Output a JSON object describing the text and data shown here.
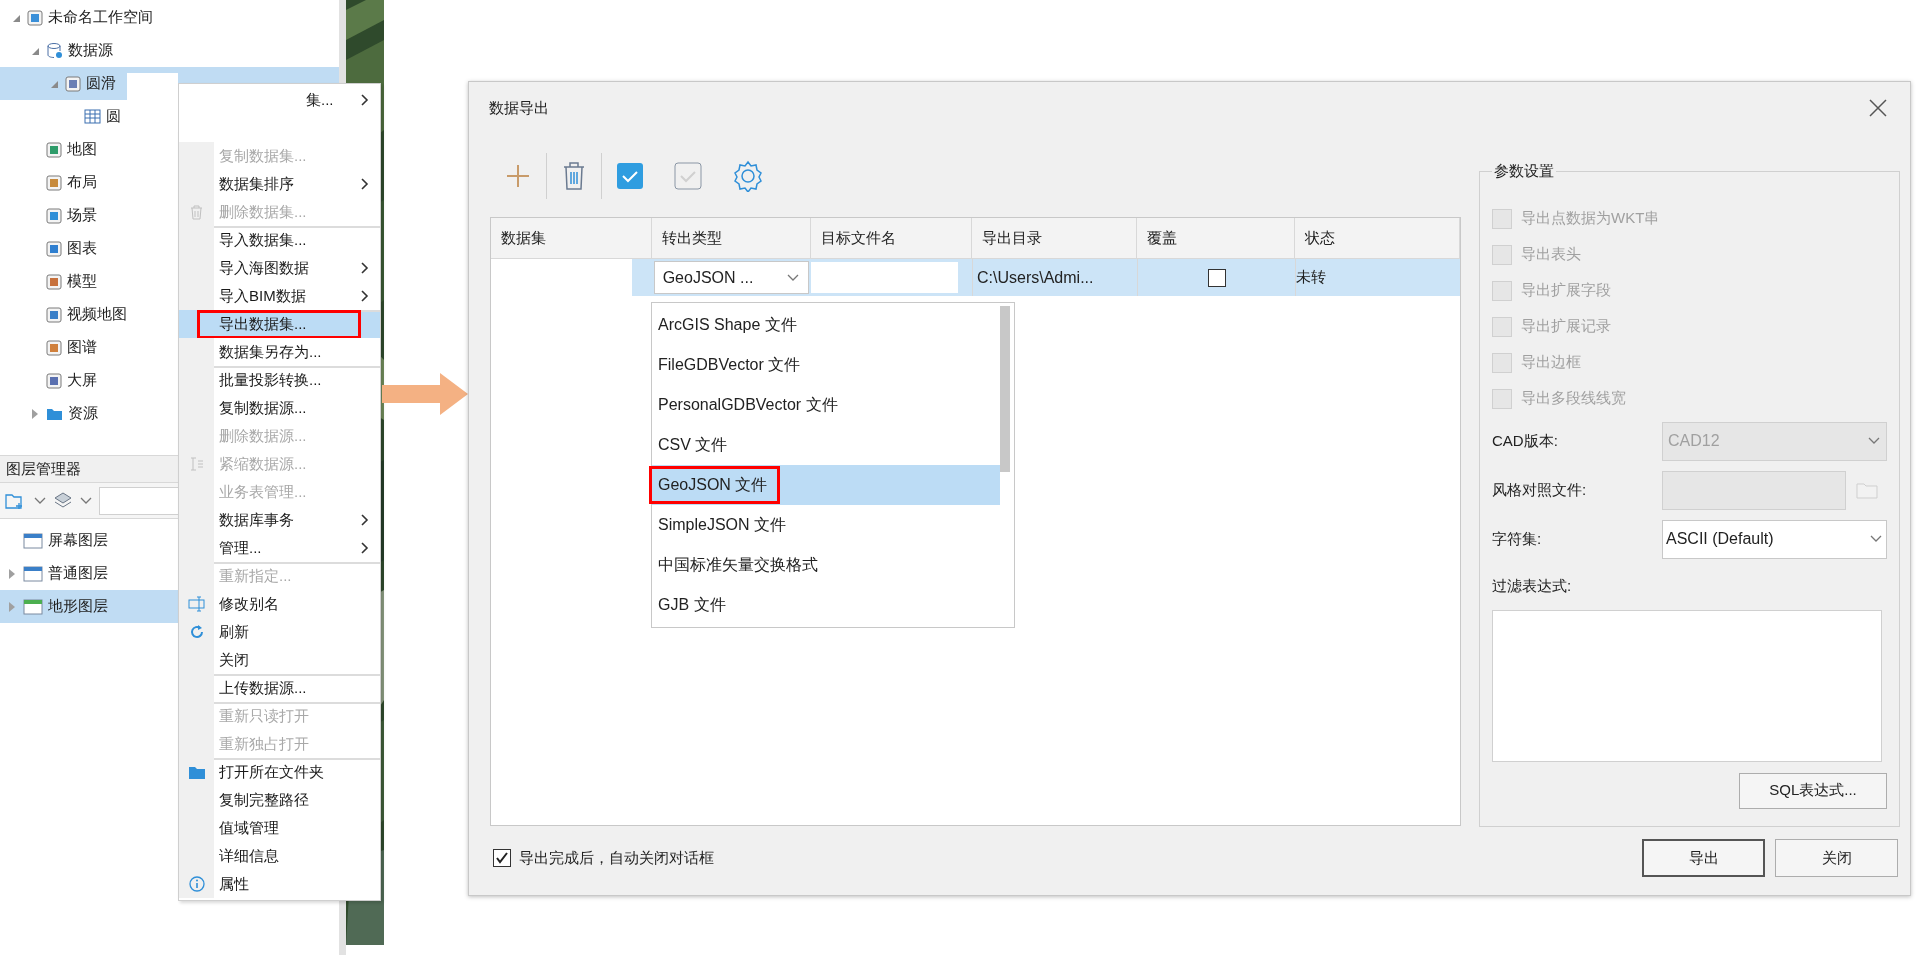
{
  "workspace_tree": {
    "items": [
      {
        "label": "未命名工作空间",
        "kind": "workspace",
        "expanded": true,
        "selected": false,
        "children": [
          {
            "label": "数据源",
            "kind": "datasource",
            "expanded": true,
            "selected": false,
            "children": [
              {
                "label": "圆滑",
                "kind": "vector",
                "expanded": true,
                "selected": true,
                "children": [
                  {
                    "label": "圆",
                    "kind": "table",
                    "selected": false
                  }
                ]
              }
            ]
          },
          {
            "label": "地图",
            "kind": "map",
            "selected": false
          },
          {
            "label": "布局",
            "kind": "layout",
            "selected": false
          },
          {
            "label": "场景",
            "kind": "scene",
            "selected": false
          },
          {
            "label": "图表",
            "kind": "chart",
            "selected": false
          },
          {
            "label": "模型",
            "kind": "model",
            "selected": false
          },
          {
            "label": "视频地图",
            "kind": "video",
            "selected": false
          },
          {
            "label": "图谱",
            "kind": "graph",
            "selected": false
          },
          {
            "label": "大屏",
            "kind": "screen",
            "selected": false
          },
          {
            "label": "资源",
            "kind": "folder",
            "expanded": false,
            "selected": false
          }
        ]
      }
    ]
  },
  "layer_manager": {
    "title": "图层管理器",
    "layers": [
      {
        "label": "屏幕图层",
        "kind": "screen",
        "selected": false
      },
      {
        "label": "普通图层",
        "kind": "normal",
        "expanded": false,
        "selected": false
      },
      {
        "label": "地形图层",
        "kind": "terrain",
        "expanded": false,
        "selected": true
      }
    ]
  },
  "context_menu": {
    "items": [
      {
        "kind": "clipped",
        "label": "集...",
        "submenu": true,
        "disabled": false,
        "selected": false,
        "separator_before": false
      },
      {
        "kind": "hidden"
      },
      {
        "kind": "plain",
        "label": "复制数据集...",
        "submenu": false,
        "disabled": true,
        "selected": false,
        "separator_before": false
      },
      {
        "kind": "plain",
        "label": "数据集排序",
        "submenu": true,
        "disabled": false,
        "selected": false,
        "separator_before": false
      },
      {
        "kind": "trash",
        "label": "删除数据集...",
        "submenu": false,
        "disabled": true,
        "selected": false,
        "separator_before": false
      },
      {
        "kind": "plain",
        "label": "导入数据集...",
        "submenu": false,
        "disabled": false,
        "selected": false,
        "separator_before": true
      },
      {
        "kind": "plain",
        "label": "导入海图数据",
        "submenu": true,
        "disabled": false,
        "selected": false,
        "separator_before": false
      },
      {
        "kind": "plain",
        "label": "导入BIM数据",
        "submenu": true,
        "disabled": false,
        "selected": false,
        "separator_before": false
      },
      {
        "kind": "plain",
        "label": "导出数据集...",
        "submenu": false,
        "disabled": false,
        "selected": true,
        "annotated": true,
        "separator_before": true
      },
      {
        "kind": "plain",
        "label": "数据集另存为...",
        "submenu": false,
        "disabled": false,
        "selected": false,
        "separator_before": false
      },
      {
        "kind": "plain",
        "label": "批量投影转换...",
        "submenu": false,
        "disabled": false,
        "selected": false,
        "separator_before": true
      },
      {
        "kind": "plain",
        "label": "复制数据源...",
        "submenu": false,
        "disabled": false,
        "selected": false,
        "separator_before": false
      },
      {
        "kind": "plain",
        "label": "删除数据源...",
        "submenu": false,
        "disabled": true,
        "selected": false,
        "separator_before": false
      },
      {
        "kind": "compact",
        "label": "紧缩数据源...",
        "submenu": false,
        "disabled": true,
        "selected": false,
        "separator_before": false
      },
      {
        "kind": "plain",
        "label": "业务表管理...",
        "submenu": false,
        "disabled": true,
        "selected": false,
        "separator_before": false
      },
      {
        "kind": "plain",
        "label": "数据库事务",
        "submenu": true,
        "disabled": false,
        "selected": false,
        "separator_before": false
      },
      {
        "kind": "plain",
        "label": "管理...",
        "submenu": true,
        "disabled": false,
        "selected": false,
        "separator_before": false
      },
      {
        "kind": "plain",
        "label": "重新指定...",
        "submenu": false,
        "disabled": true,
        "selected": false,
        "separator_before": true
      },
      {
        "kind": "rename",
        "label": "修改别名",
        "submenu": false,
        "disabled": false,
        "selected": false,
        "separator_before": false
      },
      {
        "kind": "refresh",
        "label": "刷新",
        "submenu": false,
        "disabled": false,
        "selected": false,
        "separator_before": false
      },
      {
        "kind": "plain",
        "label": "关闭",
        "submenu": false,
        "disabled": false,
        "selected": false,
        "separator_before": false
      },
      {
        "kind": "plain",
        "label": "上传数据源...",
        "submenu": false,
        "disabled": false,
        "selected": false,
        "separator_before": true
      },
      {
        "kind": "plain",
        "label": "重新只读打开",
        "submenu": false,
        "disabled": true,
        "selected": false,
        "separator_before": true
      },
      {
        "kind": "plain",
        "label": "重新独占打开",
        "submenu": false,
        "disabled": true,
        "selected": false,
        "separator_before": false
      },
      {
        "kind": "folder",
        "label": "打开所在文件夹",
        "submenu": false,
        "disabled": false,
        "selected": false,
        "separator_before": true
      },
      {
        "kind": "plain",
        "label": "复制完整路径",
        "submenu": false,
        "disabled": false,
        "selected": false,
        "separator_before": false
      },
      {
        "kind": "plain",
        "label": "值域管理",
        "submenu": false,
        "disabled": false,
        "selected": false,
        "separator_before": false
      },
      {
        "kind": "plain",
        "label": "详细信息",
        "submenu": false,
        "disabled": false,
        "selected": false,
        "separator_before": false
      },
      {
        "kind": "info",
        "label": "属性",
        "submenu": false,
        "disabled": false,
        "selected": false,
        "separator_before": false
      }
    ]
  },
  "dialog": {
    "title": "数据导出",
    "table": {
      "columns": [
        "数据集",
        "转出类型",
        "目标文件名",
        "导出目录",
        "覆盖",
        "状态"
      ],
      "rows": [
        {
          "selected": true,
          "type": "GeoJSON ...",
          "directory": "C:\\Users\\Admi...",
          "overwrite": false,
          "status": "未转"
        }
      ]
    },
    "type_options": [
      {
        "label": "ArcGIS Shape 文件",
        "selected": false
      },
      {
        "label": "FileGDBVector 文件",
        "selected": false
      },
      {
        "label": "PersonalGDBVector 文件",
        "selected": false
      },
      {
        "label": "CSV 文件",
        "selected": false
      },
      {
        "label": "GeoJSON 文件",
        "selected": true,
        "annotated": true
      },
      {
        "label": "SimpleJSON 文件",
        "selected": false
      },
      {
        "label": "中国标准矢量交换格式",
        "selected": false
      },
      {
        "label": "GJB 文件",
        "selected": false
      }
    ],
    "params": {
      "title": "参数设置",
      "checkboxes": [
        {
          "label": "导出点数据为WKT串",
          "checked": false,
          "disabled": true
        },
        {
          "label": "导出表头",
          "checked": false,
          "disabled": true
        },
        {
          "label": "导出扩展字段",
          "checked": false,
          "disabled": true
        },
        {
          "label": "导出扩展记录",
          "checked": false,
          "disabled": true
        },
        {
          "label": "导出边框",
          "checked": false,
          "disabled": true
        },
        {
          "label": "导出多段线线宽",
          "checked": false,
          "disabled": true
        }
      ],
      "cad_version": {
        "label": "CAD版本:",
        "value": "CAD12",
        "disabled": true
      },
      "style_file": {
        "label": "风格对照文件:",
        "disabled": true
      },
      "charset": {
        "label": "字符集:",
        "value": "ASCII (Default)",
        "disabled": false
      },
      "filter": {
        "label": "过滤表达式:"
      },
      "sql_button": "SQL表达式..."
    },
    "auto_close": {
      "label": "导出完成后，自动关闭对话框",
      "checked": true
    },
    "buttons": [
      {
        "label": "导出",
        "default": true
      },
      {
        "label": "关闭",
        "default": false
      }
    ]
  }
}
